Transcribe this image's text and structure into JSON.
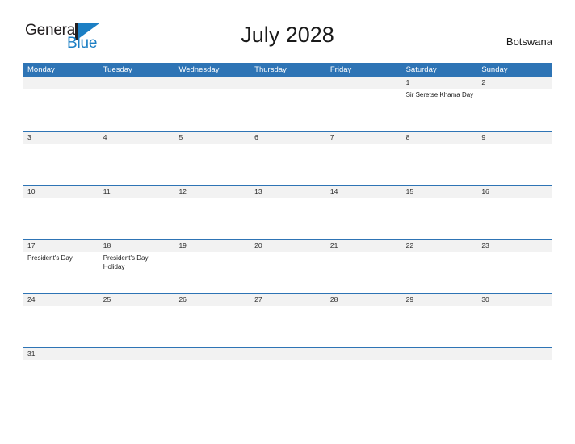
{
  "brand": {
    "name_part1": "General",
    "name_part2": "Blue",
    "accent_color": "#1c7fc4",
    "logo_icon": "blue-flag-triangle-icon"
  },
  "header": {
    "title": "July 2028",
    "region": "Botswana"
  },
  "calendar": {
    "header_bg_color": "#2e74b5",
    "date_strip_color": "#f2f2f2",
    "weekdays": [
      "Monday",
      "Tuesday",
      "Wednesday",
      "Thursday",
      "Friday",
      "Saturday",
      "Sunday"
    ],
    "weeks": [
      [
        {
          "date": "",
          "events": []
        },
        {
          "date": "",
          "events": []
        },
        {
          "date": "",
          "events": []
        },
        {
          "date": "",
          "events": []
        },
        {
          "date": "",
          "events": []
        },
        {
          "date": "1",
          "events": [
            "Sir Seretse Khama Day"
          ]
        },
        {
          "date": "2",
          "events": []
        }
      ],
      [
        {
          "date": "3",
          "events": []
        },
        {
          "date": "4",
          "events": []
        },
        {
          "date": "5",
          "events": []
        },
        {
          "date": "6",
          "events": []
        },
        {
          "date": "7",
          "events": []
        },
        {
          "date": "8",
          "events": []
        },
        {
          "date": "9",
          "events": []
        }
      ],
      [
        {
          "date": "10",
          "events": []
        },
        {
          "date": "11",
          "events": []
        },
        {
          "date": "12",
          "events": []
        },
        {
          "date": "13",
          "events": []
        },
        {
          "date": "14",
          "events": []
        },
        {
          "date": "15",
          "events": []
        },
        {
          "date": "16",
          "events": []
        }
      ],
      [
        {
          "date": "17",
          "events": [
            "President's Day"
          ]
        },
        {
          "date": "18",
          "events": [
            "President's Day Holiday"
          ]
        },
        {
          "date": "19",
          "events": []
        },
        {
          "date": "20",
          "events": []
        },
        {
          "date": "21",
          "events": []
        },
        {
          "date": "22",
          "events": []
        },
        {
          "date": "23",
          "events": []
        }
      ],
      [
        {
          "date": "24",
          "events": []
        },
        {
          "date": "25",
          "events": []
        },
        {
          "date": "26",
          "events": []
        },
        {
          "date": "27",
          "events": []
        },
        {
          "date": "28",
          "events": []
        },
        {
          "date": "29",
          "events": []
        },
        {
          "date": "30",
          "events": []
        }
      ],
      [
        {
          "date": "31",
          "events": []
        },
        {
          "date": "",
          "events": []
        },
        {
          "date": "",
          "events": []
        },
        {
          "date": "",
          "events": []
        },
        {
          "date": "",
          "events": []
        },
        {
          "date": "",
          "events": []
        },
        {
          "date": "",
          "events": []
        }
      ]
    ]
  }
}
